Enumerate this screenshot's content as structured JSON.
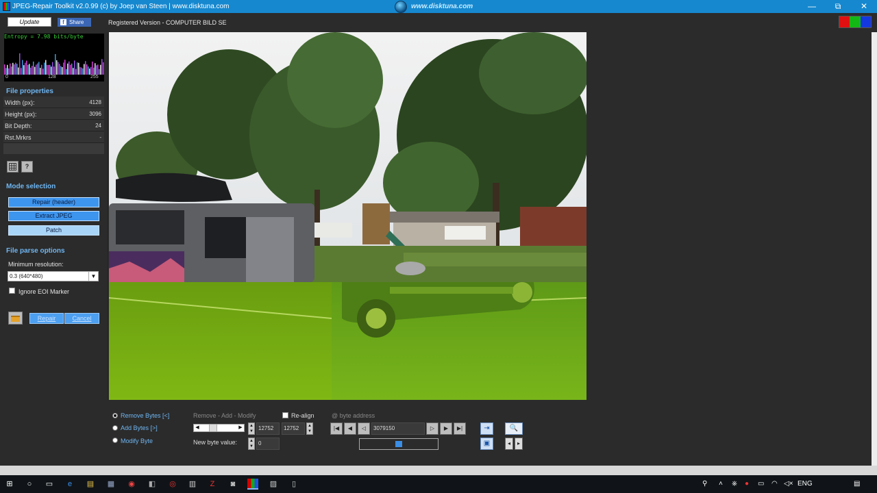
{
  "window": {
    "title": "JPEG-Repair Toolkit v2.0.99 (c) by Joep van Steen | www.disktuna.com",
    "center_logo": "www.disktuna.com",
    "minimize": "—",
    "maximize": "⧉",
    "close": "✕"
  },
  "topbar": {
    "update_label": "Update",
    "share_label": "Share",
    "registered": "Registered Version - COMPUTER BILD SE"
  },
  "entropy": {
    "label": "Entropy = 7.98 bits/byte",
    "ticks": [
      "0",
      "128",
      "255"
    ]
  },
  "file_properties": {
    "header": "File properties",
    "rows": [
      {
        "key": "Width (px):",
        "value": "4128"
      },
      {
        "key": "Height (px):",
        "value": "3096"
      },
      {
        "key": "Bit Depth:",
        "value": "24"
      },
      {
        "key": "Rst.Mrkrs",
        "value": "-"
      }
    ]
  },
  "tools": {
    "grid_icon": "grid-icon",
    "help_label": "?"
  },
  "mode_selection": {
    "header": "Mode selection",
    "repair_label": "Repair (header)",
    "extract_label": "Extract JPEG",
    "patch_label": "Patch"
  },
  "parse_options": {
    "header": "File parse options",
    "min_res_label": "Minimum resolution:",
    "min_res_value": "0.3 (640*480)",
    "ignore_eoi_label": "Ignore EOI Marker"
  },
  "actions": {
    "repair_label": "Repair",
    "cancel_label": "Cancel"
  },
  "controls": {
    "remove_bytes": "Remove Bytes [<]",
    "add_bytes": "Add Bytes [>]",
    "modify_byte": "Modify Byte",
    "ram_label": "Remove - Add - Modify",
    "realign_label": "Re-align",
    "byte_address_label": "@ byte address",
    "value1": "12752",
    "value2": "12752",
    "address_value": "3079150",
    "new_byte_label": "New byte value:",
    "new_byte_value": "0"
  },
  "taskbar": {
    "language": "ENG"
  },
  "colors": {
    "titlebar": "#1688cf",
    "accent_text": "#6fb6f2",
    "mode_selected": "#3d95ee"
  }
}
